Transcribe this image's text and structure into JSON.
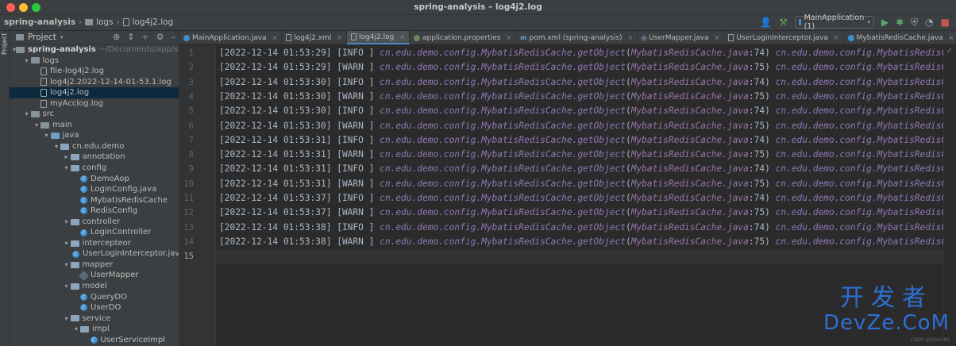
{
  "window": {
    "title": "spring-analysis – log4j2.log"
  },
  "breadcrumb": [
    "spring-analysis",
    "logs",
    "log4j2.log"
  ],
  "toolbar": {
    "run_config": "MainApplication (1)"
  },
  "project": {
    "header": "Project",
    "strip_label": "Project",
    "tree": [
      {
        "label": "spring-analysis",
        "extra": "~/Documents/app/spring-a",
        "depth": 0,
        "icon": "folder",
        "arrow": "▾",
        "bold": true
      },
      {
        "label": "logs",
        "depth": 1,
        "icon": "folder",
        "arrow": "▾"
      },
      {
        "label": "file-log4j2.log",
        "depth": 2,
        "icon": "log",
        "arrow": ""
      },
      {
        "label": "log4j2.2022-12-14-01-53.1.log",
        "depth": 2,
        "icon": "log",
        "arrow": ""
      },
      {
        "label": "log4j2.log",
        "depth": 2,
        "icon": "log",
        "arrow": "",
        "selected": true
      },
      {
        "label": "myAcclog.log",
        "depth": 2,
        "icon": "log",
        "arrow": ""
      },
      {
        "label": "src",
        "depth": 1,
        "icon": "folder",
        "arrow": "▾"
      },
      {
        "label": "main",
        "depth": 2,
        "icon": "folder",
        "arrow": "▾"
      },
      {
        "label": "java",
        "depth": 3,
        "icon": "folder-blue",
        "arrow": "▾"
      },
      {
        "label": "cn.edu.demo",
        "depth": 4,
        "icon": "pkg",
        "arrow": "▾"
      },
      {
        "label": "annotation",
        "depth": 5,
        "icon": "pkg",
        "arrow": "▸"
      },
      {
        "label": "config",
        "depth": 5,
        "icon": "pkg",
        "arrow": "▾"
      },
      {
        "label": "DemoAop",
        "depth": 6,
        "icon": "cls",
        "arrow": ""
      },
      {
        "label": "LoginConfig.java",
        "depth": 6,
        "icon": "cls",
        "arrow": ""
      },
      {
        "label": "MybatisRedisCache",
        "depth": 6,
        "icon": "cls",
        "arrow": ""
      },
      {
        "label": "RedisConfig",
        "depth": 6,
        "icon": "cls",
        "arrow": ""
      },
      {
        "label": "controller",
        "depth": 5,
        "icon": "pkg",
        "arrow": "▾"
      },
      {
        "label": "LoginController",
        "depth": 6,
        "icon": "cls",
        "arrow": ""
      },
      {
        "label": "intercepteor",
        "depth": 5,
        "icon": "pkg",
        "arrow": "▾"
      },
      {
        "label": "UserLoginInterceptor.java",
        "depth": 6,
        "icon": "cls",
        "arrow": ""
      },
      {
        "label": "mapper",
        "depth": 5,
        "icon": "pkg",
        "arrow": "▾"
      },
      {
        "label": "UserMapper",
        "depth": 6,
        "icon": "mapper",
        "arrow": ""
      },
      {
        "label": "model",
        "depth": 5,
        "icon": "pkg",
        "arrow": "▾"
      },
      {
        "label": "QueryDO",
        "depth": 6,
        "icon": "cls",
        "arrow": ""
      },
      {
        "label": "UserDO",
        "depth": 6,
        "icon": "cls",
        "arrow": ""
      },
      {
        "label": "service",
        "depth": 5,
        "icon": "pkg",
        "arrow": "▾"
      },
      {
        "label": "impl",
        "depth": 6,
        "icon": "pkg",
        "arrow": "▾"
      },
      {
        "label": "UserServiceImpl",
        "depth": 7,
        "icon": "cls",
        "arrow": ""
      }
    ]
  },
  "tabs": [
    {
      "label": "MainApplication.java",
      "icon": "java"
    },
    {
      "label": "log4j2.xml",
      "icon": "file"
    },
    {
      "label": "log4j2.log",
      "icon": "file",
      "active": true
    },
    {
      "label": "application.properties",
      "icon": "prop"
    },
    {
      "label": "pom.xml (spring-analysis)",
      "icon": "pom"
    },
    {
      "label": "UserMapper.java",
      "icon": "map"
    },
    {
      "label": "UserLoginInterceptor.java",
      "icon": "file"
    },
    {
      "label": "MybatisRedisCache.java",
      "icon": "java"
    }
  ],
  "log_lines": [
    {
      "n": "1",
      "ts": "[2022-12-14 01:53:29]",
      "lvl": "[INFO ]",
      "line": "74"
    },
    {
      "n": "2",
      "ts": "[2022-12-14 01:53:29]",
      "lvl": "[WARN ]",
      "line": "75"
    },
    {
      "n": "3",
      "ts": "[2022-12-14 01:53:30]",
      "lvl": "[INFO ]",
      "line": "74"
    },
    {
      "n": "4",
      "ts": "[2022-12-14 01:53:30]",
      "lvl": "[WARN ]",
      "line": "75"
    },
    {
      "n": "5",
      "ts": "[2022-12-14 01:53:30]",
      "lvl": "[INFO ]",
      "line": "74"
    },
    {
      "n": "6",
      "ts": "[2022-12-14 01:53:30]",
      "lvl": "[WARN ]",
      "line": "75"
    },
    {
      "n": "7",
      "ts": "[2022-12-14 01:53:31]",
      "lvl": "[INFO ]",
      "line": "74"
    },
    {
      "n": "8",
      "ts": "[2022-12-14 01:53:31]",
      "lvl": "[WARN ]",
      "line": "75"
    },
    {
      "n": "9",
      "ts": "[2022-12-14 01:53:31]",
      "lvl": "[INFO ]",
      "line": "74"
    },
    {
      "n": "10",
      "ts": "[2022-12-14 01:53:31]",
      "lvl": "[WARN ]",
      "line": "75"
    },
    {
      "n": "11",
      "ts": "[2022-12-14 01:53:37]",
      "lvl": "[INFO ]",
      "line": "74"
    },
    {
      "n": "12",
      "ts": "[2022-12-14 01:53:37]",
      "lvl": "[WARN ]",
      "line": "75"
    },
    {
      "n": "13",
      "ts": "[2022-12-14 01:53:38]",
      "lvl": "[INFO ]",
      "line": "74"
    },
    {
      "n": "14",
      "ts": "[2022-12-14 01:53:38]",
      "lvl": "[WARN ]",
      "line": "75"
    }
  ],
  "log_text": {
    "method": "cn.edu.demo.config.MybatisRedisCache.getObject",
    "file": "MybatisRedisCache.java",
    "tail": "cn.edu.demo.config.MybatisRedisCache -"
  },
  "last_line_number": "15",
  "watermark": {
    "cn": "开发者",
    "en": "DevZe.CoM",
    "small": "CSDN @Stalin89"
  },
  "colors": {
    "accent": "#4a88c7",
    "selection": "#0d293e",
    "watermark": "#2d6fd4"
  }
}
